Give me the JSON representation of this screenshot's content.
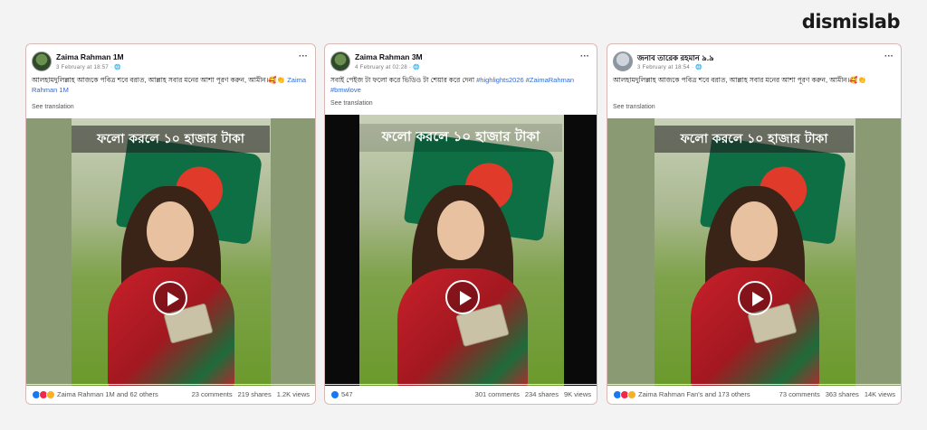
{
  "brand": "dismislab",
  "posts": [
    {
      "author": "Zaima Rahman 1M",
      "date": "3 February at 18:57 · 🌐",
      "caption_text": "আলহামদুলিল্লাহ আজকে পবিত্র শবে বরাত, আল্লাহ সবার মনের আশা পূরণ করুন, আমীন।🥰👏",
      "caption_tag": "Zaima Rahman 1M",
      "see_translation": "See translation",
      "overlay": "ফলো করলে ১০ হাজার টাকা",
      "reactions_text": "Zaima Rahman 1M and 62 others",
      "comments": "23 comments",
      "shares": "219 shares",
      "views": "1.2K views"
    },
    {
      "author": "Zaima Rahman 3M",
      "date": "4 February at 02:28 · 🌐",
      "caption_text": "সবাই পেইজ টা ফলো করে ভিডিও টা শেয়ার করে দেনা",
      "caption_tag": "#highlights2026 #ZaimaRahman #bmwlove",
      "see_translation": "See translation",
      "overlay": "ফলো করলে ১০ হাজার টাকা",
      "reactions_text": "547",
      "comments": "301 comments",
      "shares": "234 shares",
      "views": "9K views"
    },
    {
      "author": "জনাব তারেক রহমান ৯.৯",
      "date": "3 February at 18:54 · 🌐",
      "caption_text": "আলহামদুলিল্লাহ আজকে পবিত্র শবে বরাত, আল্লাহ সবার মনের আশা পূরণ করুন, আমীন।🥰👏",
      "caption_tag": "",
      "see_translation": "See translation",
      "overlay": "ফলো করলে ১০ হাজার টাকা",
      "reactions_text": "Zaima Rahman Fan's and 173 others",
      "comments": "73 comments",
      "shares": "363 shares",
      "views": "14K views"
    }
  ],
  "colors": {
    "card_border": "#d9b9b6",
    "flag_green": "#0e6e44",
    "flag_red": "#e03a2a",
    "link_blue": "#2e6bd8"
  }
}
